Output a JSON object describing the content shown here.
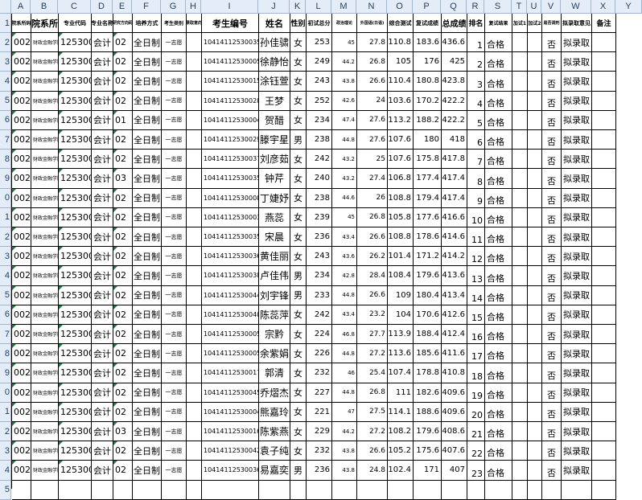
{
  "spreadsheet": {
    "column_letters": [
      "A",
      "B",
      "C",
      "D",
      "E",
      "F",
      "G",
      "H",
      "I",
      "J",
      "K",
      "L",
      "M",
      "N",
      "O",
      "P",
      "Q",
      "R",
      "S",
      "T",
      "U",
      "V",
      "W",
      "X",
      "Y"
    ],
    "row_numbers": [
      "1",
      "2",
      "3",
      "4",
      "5",
      "6",
      "7",
      "8",
      "9",
      "0",
      "1",
      "2",
      "3",
      "4",
      "5",
      "6",
      "7",
      "8",
      "9",
      "0",
      "1",
      "2",
      "3",
      "4",
      "5"
    ],
    "header": [
      "院系所码",
      "院系所",
      "专业代码",
      "专业名称",
      "研究方向码",
      "培养方式",
      "考生类别",
      "录取意向",
      "考生编号",
      "姓名",
      "性别",
      "初试总分",
      "政治理论",
      "外国语(日语)",
      "综合测试",
      "复试成绩",
      "总成绩",
      "排名",
      "复试结果",
      "加试1",
      "加试2",
      "是否调剂",
      "拟录取意见",
      "备注"
    ],
    "rows": [
      [
        "002",
        "财政金融学院",
        "125300",
        "会计",
        "02",
        "全日制",
        "一志愿",
        "",
        "104141125300354",
        "孙佳骕",
        "女",
        "253",
        "45",
        "27.8",
        "110.8",
        "183.6",
        "436.6",
        "1",
        "合格",
        "",
        "",
        "否",
        "拟录取",
        ""
      ],
      [
        "002",
        "财政金融学院",
        "125300",
        "会计",
        "02",
        "全日制",
        "一志愿",
        "",
        "104141125300054",
        "徐静怡",
        "女",
        "249",
        "44.2",
        "26.8",
        "105",
        "176",
        "425",
        "2",
        "合格",
        "",
        "",
        "否",
        "拟录取",
        ""
      ],
      [
        "002",
        "财政金融学院",
        "125300",
        "会计",
        "02",
        "全日制",
        "一志愿",
        "",
        "104141125300152",
        "涂钰萱",
        "女",
        "243",
        "43.8",
        "26.6",
        "110.4",
        "180.8",
        "423.8",
        "3",
        "合格",
        "",
        "",
        "否",
        "拟录取",
        ""
      ],
      [
        "002",
        "财政金融学院",
        "125300",
        "会计",
        "02",
        "全日制",
        "一志愿",
        "",
        "104141125300281",
        "王梦",
        "女",
        "252",
        "42.6",
        "24",
        "103.6",
        "170.2",
        "422.2",
        "4",
        "合格",
        "",
        "",
        "否",
        "拟录取",
        ""
      ],
      [
        "002",
        "财政金融学院",
        "125300",
        "会计",
        "01",
        "全日制",
        "一志愿",
        "",
        "104141125300042",
        "贺醋",
        "女",
        "234",
        "47.4",
        "27.6",
        "113.2",
        "188.2",
        "422.2",
        "5",
        "合格",
        "",
        "",
        "否",
        "拟录取",
        ""
      ],
      [
        "002",
        "财政金融学院",
        "125300",
        "会计",
        "02",
        "全日制",
        "一志愿",
        "",
        "104141125300292",
        "滕宇星",
        "男",
        "238",
        "44.8",
        "27.6",
        "107.6",
        "180",
        "418",
        "6",
        "合格",
        "",
        "",
        "否",
        "拟录取",
        ""
      ],
      [
        "002",
        "财政金融学院",
        "125300",
        "会计",
        "02",
        "全日制",
        "一志愿",
        "",
        "104141125300370",
        "刘彦茹",
        "女",
        "242",
        "43.2",
        "25",
        "107.6",
        "175.8",
        "417.8",
        "7",
        "合格",
        "",
        "",
        "否",
        "拟录取",
        ""
      ],
      [
        "002",
        "财政金融学院",
        "125300",
        "会计",
        "03",
        "全日制",
        "一志愿",
        "",
        "104141125300358",
        "钟芹",
        "女",
        "240",
        "43.2",
        "27.4",
        "106.8",
        "177.4",
        "417.4",
        "8",
        "合格",
        "",
        "",
        "否",
        "拟录取",
        ""
      ],
      [
        "002",
        "财政金融学院",
        "125300",
        "会计",
        "02",
        "全日制",
        "一志愿",
        "",
        "104141125300082",
        "丁婕妤",
        "女",
        "238",
        "44.6",
        "26",
        "108.8",
        "179.4",
        "417.4",
        "9",
        "合格",
        "",
        "",
        "否",
        "拟录取",
        ""
      ],
      [
        "002",
        "财政金融学院",
        "125300",
        "会计",
        "02",
        "全日制",
        "一志愿",
        "",
        "104141125300033",
        "燕蕊",
        "女",
        "239",
        "45",
        "26.8",
        "105.8",
        "177.6",
        "416.6",
        "10",
        "合格",
        "",
        "",
        "否",
        "拟录取",
        ""
      ],
      [
        "002",
        "财政金融学院",
        "125300",
        "会计",
        "02",
        "全日制",
        "一志愿",
        "",
        "104141125300353",
        "宋晨",
        "女",
        "236",
        "43.4",
        "26.6",
        "108.8",
        "178.6",
        "414.6",
        "11",
        "合格",
        "",
        "",
        "否",
        "拟录取",
        ""
      ],
      [
        "002",
        "财政金融学院",
        "125300",
        "会计",
        "02",
        "全日制",
        "一志愿",
        "",
        "104141125300363",
        "黄佳丽",
        "女",
        "243",
        "43.6",
        "26.2",
        "101.4",
        "171.2",
        "414.2",
        "12",
        "合格",
        "",
        "",
        "否",
        "拟录取",
        ""
      ],
      [
        "002",
        "财政金融学院",
        "125300",
        "会计",
        "02",
        "全日制",
        "一志愿",
        "",
        "104141125300386",
        "卢佳伟",
        "男",
        "234",
        "42.8",
        "28.4",
        "108.4",
        "179.6",
        "413.6",
        "13",
        "合格",
        "",
        "",
        "否",
        "拟录取",
        ""
      ],
      [
        "002",
        "财政金融学院",
        "125300",
        "会计",
        "02",
        "全日制",
        "一志愿",
        "",
        "104141125300440",
        "刘宇锋",
        "男",
        "233",
        "44.8",
        "26.6",
        "109",
        "180.4",
        "413.4",
        "14",
        "合格",
        "",
        "",
        "否",
        "拟录取",
        ""
      ],
      [
        "002",
        "财政金融学院",
        "125300",
        "会计",
        "02",
        "全日制",
        "一志愿",
        "",
        "104141125300407",
        "陈蕊萍",
        "女",
        "242",
        "43.4",
        "23.2",
        "104",
        "170.6",
        "412.6",
        "15",
        "合格",
        "",
        "",
        "否",
        "拟录取",
        ""
      ],
      [
        "002",
        "财政金融学院",
        "125300",
        "会计",
        "02",
        "全日制",
        "一志愿",
        "",
        "104141125300053",
        "宗黔",
        "女",
        "224",
        "46.8",
        "27.7",
        "113.9",
        "188.4",
        "412.4",
        "16",
        "合格",
        "",
        "",
        "否",
        "拟录取",
        ""
      ],
      [
        "002",
        "财政金融学院",
        "125300",
        "会计",
        "02",
        "全日制",
        "一志愿",
        "",
        "104141125300051",
        "余紫娟",
        "女",
        "226",
        "44.8",
        "27.2",
        "113.6",
        "185.6",
        "411.6",
        "17",
        "合格",
        "",
        "",
        "否",
        "拟录取",
        ""
      ],
      [
        "002",
        "财政金融学院",
        "125300",
        "会计",
        "02",
        "全日制",
        "一志愿",
        "",
        "104141125300178",
        "郭清",
        "女",
        "232",
        "46",
        "25.4",
        "107.4",
        "178.8",
        "410.8",
        "18",
        "合格",
        "",
        "",
        "否",
        "拟录取",
        ""
      ],
      [
        "002",
        "财政金融学院",
        "125300",
        "会计",
        "02",
        "全日制",
        "一志愿",
        "",
        "104141125300456",
        "乔熠杰",
        "女",
        "227",
        "44.8",
        "26.8",
        "111",
        "182.6",
        "409.6",
        "19",
        "合格",
        "",
        "",
        "否",
        "拟录取",
        ""
      ],
      [
        "002",
        "财政金融学院",
        "125300",
        "会计",
        "02",
        "全日制",
        "一志愿",
        "",
        "104141125300040",
        "熊嘉玲",
        "女",
        "221",
        "47",
        "27.5",
        "114.1",
        "188.6",
        "409.6",
        "20",
        "合格",
        "",
        "",
        "否",
        "拟录取",
        ""
      ],
      [
        "002",
        "财政金融学院",
        "125300",
        "会计",
        "03",
        "全日制",
        "一志愿",
        "",
        "104141125300163",
        "陈紫燕",
        "女",
        "229",
        "44.2",
        "27.2",
        "108.2",
        "179.6",
        "408.6",
        "21",
        "合格",
        "",
        "",
        "否",
        "拟录取",
        ""
      ],
      [
        "002",
        "财政金融学院",
        "125300",
        "会计",
        "02",
        "全日制",
        "一志愿",
        "",
        "104141125300425",
        "袁子纯",
        "女",
        "232",
        "43.8",
        "26.6",
        "105.2",
        "175.6",
        "407.6",
        "22",
        "合格",
        "",
        "",
        "否",
        "拟录取",
        ""
      ],
      [
        "002",
        "财政金融学院",
        "125300",
        "会计",
        "02",
        "全日制",
        "一志愿",
        "",
        "104141125300365",
        "易嘉奕",
        "男",
        "236",
        "43.8",
        "24.8",
        "102.4",
        "171",
        "407",
        "23",
        "合格",
        "",
        "",
        "否",
        "拟录取",
        ""
      ],
      [
        "",
        "",
        "",
        "",
        "",
        "",
        "",
        "",
        "",
        "",
        "",
        "",
        "",
        "",
        "",
        "",
        "",
        "",
        "",
        "",
        "",
        "",
        "",
        "",
        ""
      ]
    ],
    "colors": {
      "header_bg": "#e4ecf7",
      "header_border": "#9eb6ce",
      "header_text": "#27415f",
      "grid_line": "#000000",
      "error_marker": "#1f7a3a"
    }
  }
}
